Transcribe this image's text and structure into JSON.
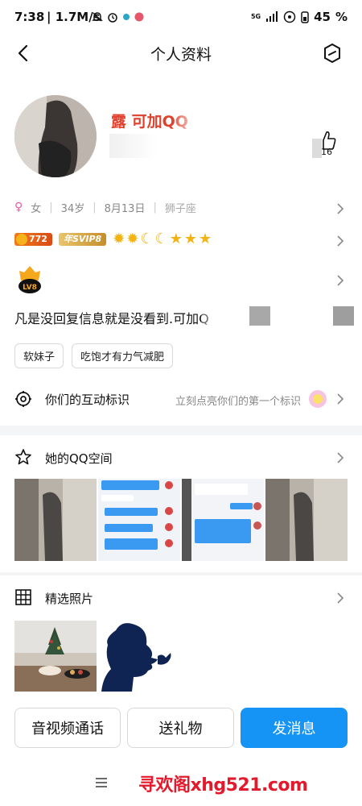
{
  "status_bar": {
    "time": "7:38",
    "speed": "| 1.7M/s",
    "network": "5G",
    "battery": "45",
    "battery_unit": "%"
  },
  "nav": {
    "title": "个人资料",
    "back_icon": "chevron-left-icon",
    "more_icon": "hexagon-edit-icon"
  },
  "profile": {
    "nickname": "露 可加QQ",
    "like_count": "16",
    "gender": "女",
    "age": "34岁",
    "birthday": "8月13日",
    "zodiac": "狮子座",
    "level_badge": "772",
    "svip_badge": "年SVIP8",
    "level_icons": [
      "sun",
      "sun",
      "moon",
      "moon",
      "star",
      "star",
      "star"
    ],
    "medal_label": "LV8",
    "signature": "凡是没回复信息就是没看到.可加Q",
    "tags": [
      "软妹子",
      "吃饱才有力气减肥"
    ]
  },
  "interaction": {
    "label": "你们的互动标识",
    "hint": "立刻点亮你们的第一个标识"
  },
  "qzone": {
    "title": "她的QQ空间"
  },
  "photos": {
    "title": "精选照片"
  },
  "actions": {
    "call": "音视频通话",
    "gift": "送礼物",
    "message": "发消息"
  },
  "watermark": "寻欢阁xhg521.com",
  "colors": {
    "accent": "#1594f6",
    "nickname": "#e0402c",
    "watermark": "#e3192c"
  }
}
